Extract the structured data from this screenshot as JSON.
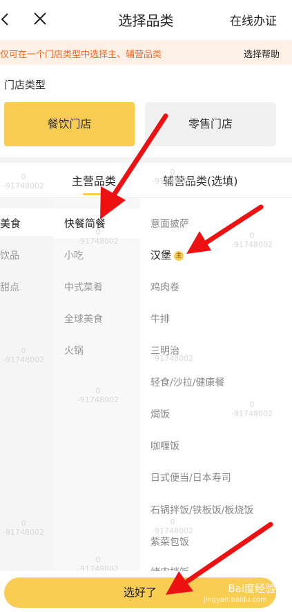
{
  "header": {
    "title": "选择品类",
    "right_link": "在线办证"
  },
  "notice": {
    "text": "仅可在一个门店类型中选择主、辅营品类",
    "help": "选择帮助"
  },
  "store_type": {
    "label": "门店类型",
    "options": [
      "餐饮门店",
      "零售门店"
    ],
    "selected": "餐饮门店"
  },
  "tabs": {
    "main": "主营品类",
    "aux": "辅营品类(选填)"
  },
  "column1": [
    "美食",
    "饮品",
    "甜点"
  ],
  "column2": [
    "快餐简餐",
    "小吃",
    "中式菜肴",
    "全球美食",
    "火锅"
  ],
  "column3": [
    "意面披萨",
    "汉堡",
    "鸡肉卷",
    "牛排",
    "三明治",
    "轻食/沙拉/健康餐",
    "焗饭",
    "咖喱饭",
    "日式便当/日本寿司",
    "石锅拌饭/铁板饭/板烧饭",
    "紫菜包饭",
    "烤肉拌饭"
  ],
  "main_badge": "主",
  "watermark": {
    "line1": "0",
    "line2": "-91748002"
  },
  "confirm_button": "选好了",
  "baidu_watermark": {
    "brand": "Bai度经验",
    "url": "jingyan.baidu.com"
  },
  "colors": {
    "accent": "#f9cc52",
    "notice_text": "#f06a20",
    "notice_bg": "#fdf0e6",
    "arrow": "#ee1111"
  }
}
